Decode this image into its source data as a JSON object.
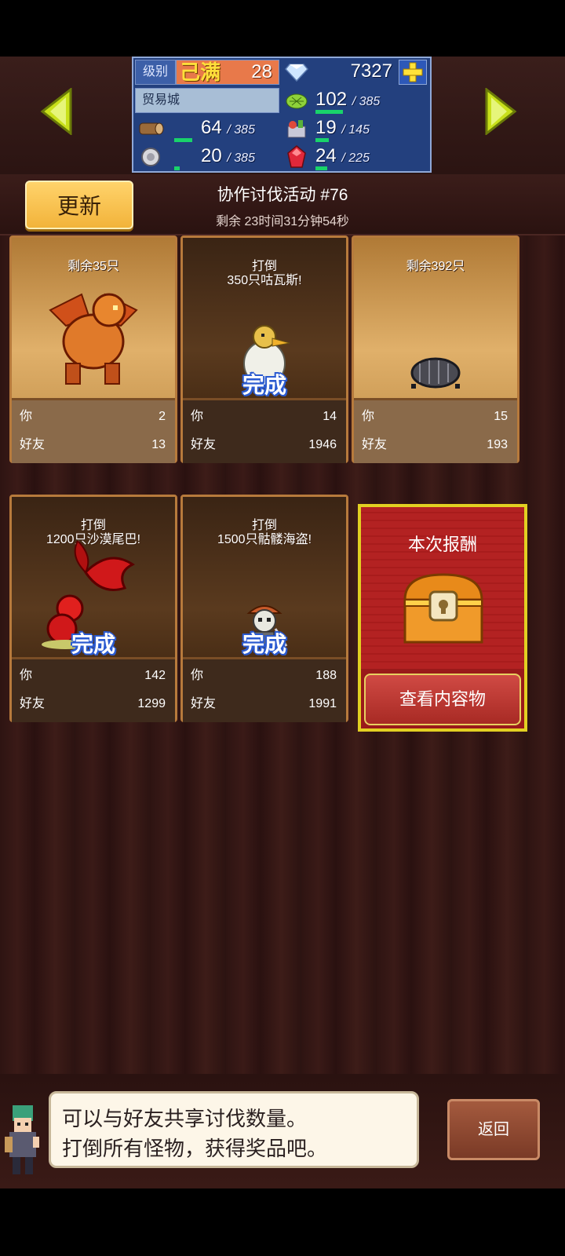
{
  "colors": {
    "accent_gold": "#f2b33a",
    "done_blue": "#2a5ad0",
    "reward_red": "#b32222",
    "gauge_green": "#19d36a"
  },
  "stats": {
    "level_label": "级别",
    "level_status": "己满",
    "level_value": "28",
    "diamonds": "7327",
    "town_name": "贸易城",
    "grass": {
      "current": "102",
      "max": "/ 385",
      "fill": 0.26
    },
    "wood": {
      "current": "64",
      "max": "/ 385",
      "fill": 0.17
    },
    "food": {
      "current": "19",
      "max": "/ 145",
      "fill": 0.13
    },
    "ore": {
      "current": "20",
      "max": "/ 385",
      "fill": 0.05
    },
    "gem": {
      "current": "24",
      "max": "/ 225",
      "fill": 0.11
    }
  },
  "header": {
    "refresh_label": "更新",
    "event_title": "协作讨伐活动 #76",
    "remaining": "剩余 23时间31分钟54秒"
  },
  "cards": [
    {
      "title": "剩余35只",
      "done": "",
      "you_label": "你",
      "you": "2",
      "friend_label": "好友",
      "friend": "13",
      "monster": "dragon"
    },
    {
      "title": "打倒\n350只咕瓦斯!",
      "done": "完成",
      "you_label": "你",
      "you": "14",
      "friend_label": "好友",
      "friend": "1946",
      "monster": "bird"
    },
    {
      "title": "剩余392只",
      "done": "",
      "you_label": "你",
      "you": "15",
      "friend_label": "好友",
      "friend": "193",
      "monster": "bug"
    },
    {
      "title": "打倒\n1200只沙漠尾巴!",
      "done": "完成",
      "you_label": "你",
      "you": "142",
      "friend_label": "好友",
      "friend": "1299",
      "monster": "tail"
    },
    {
      "title": "打倒\n1500只骷髅海盗!",
      "done": "完成",
      "you_label": "你",
      "you": "188",
      "friend_label": "好友",
      "friend": "1991",
      "monster": "pirate"
    }
  ],
  "reward": {
    "title": "本次报酬",
    "button": "查看内容物"
  },
  "footer": {
    "line1": "可以与好友共享讨伐数量。",
    "line2": "打倒所有怪物，获得奖品吧。",
    "back_label": "返回"
  }
}
